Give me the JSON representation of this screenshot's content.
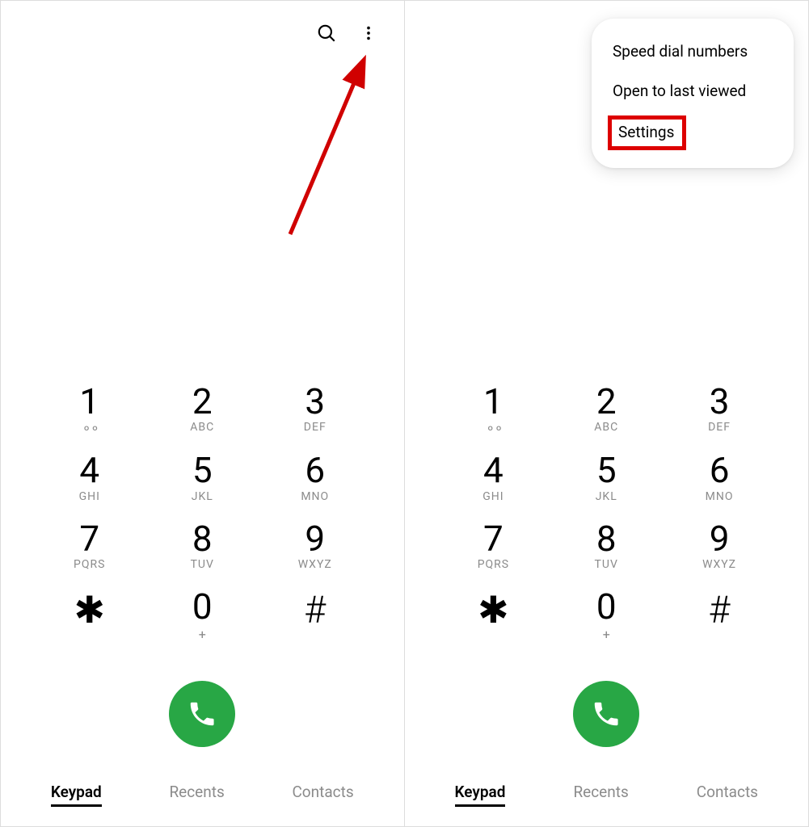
{
  "colors": {
    "call_button": "#28a745",
    "annotation_red": "#d00000",
    "subtext": "#8b8b8b"
  },
  "keypad": {
    "k1": {
      "digit": "1",
      "sub_is_voicemail": true
    },
    "k2": {
      "digit": "2",
      "sub": "ABC"
    },
    "k3": {
      "digit": "3",
      "sub": "DEF"
    },
    "k4": {
      "digit": "4",
      "sub": "GHI"
    },
    "k5": {
      "digit": "5",
      "sub": "JKL"
    },
    "k6": {
      "digit": "6",
      "sub": "MNO"
    },
    "k7": {
      "digit": "7",
      "sub": "PQRS"
    },
    "k8": {
      "digit": "8",
      "sub": "TUV"
    },
    "k9": {
      "digit": "9",
      "sub": "WXYZ"
    },
    "kstar": {
      "symbol": "✱"
    },
    "k0": {
      "digit": "0",
      "sub": "+"
    },
    "khash": {
      "symbol": "#"
    }
  },
  "tabs": {
    "keypad": "Keypad",
    "recents": "Recents",
    "contacts": "Contacts"
  },
  "menu": {
    "speed_dial": "Speed dial numbers",
    "open_last": "Open to last viewed",
    "settings": "Settings"
  },
  "icons": {
    "search": "search-icon",
    "more": "more-vert-icon",
    "call": "phone-handset-icon",
    "voicemail": "voicemail-icon"
  }
}
